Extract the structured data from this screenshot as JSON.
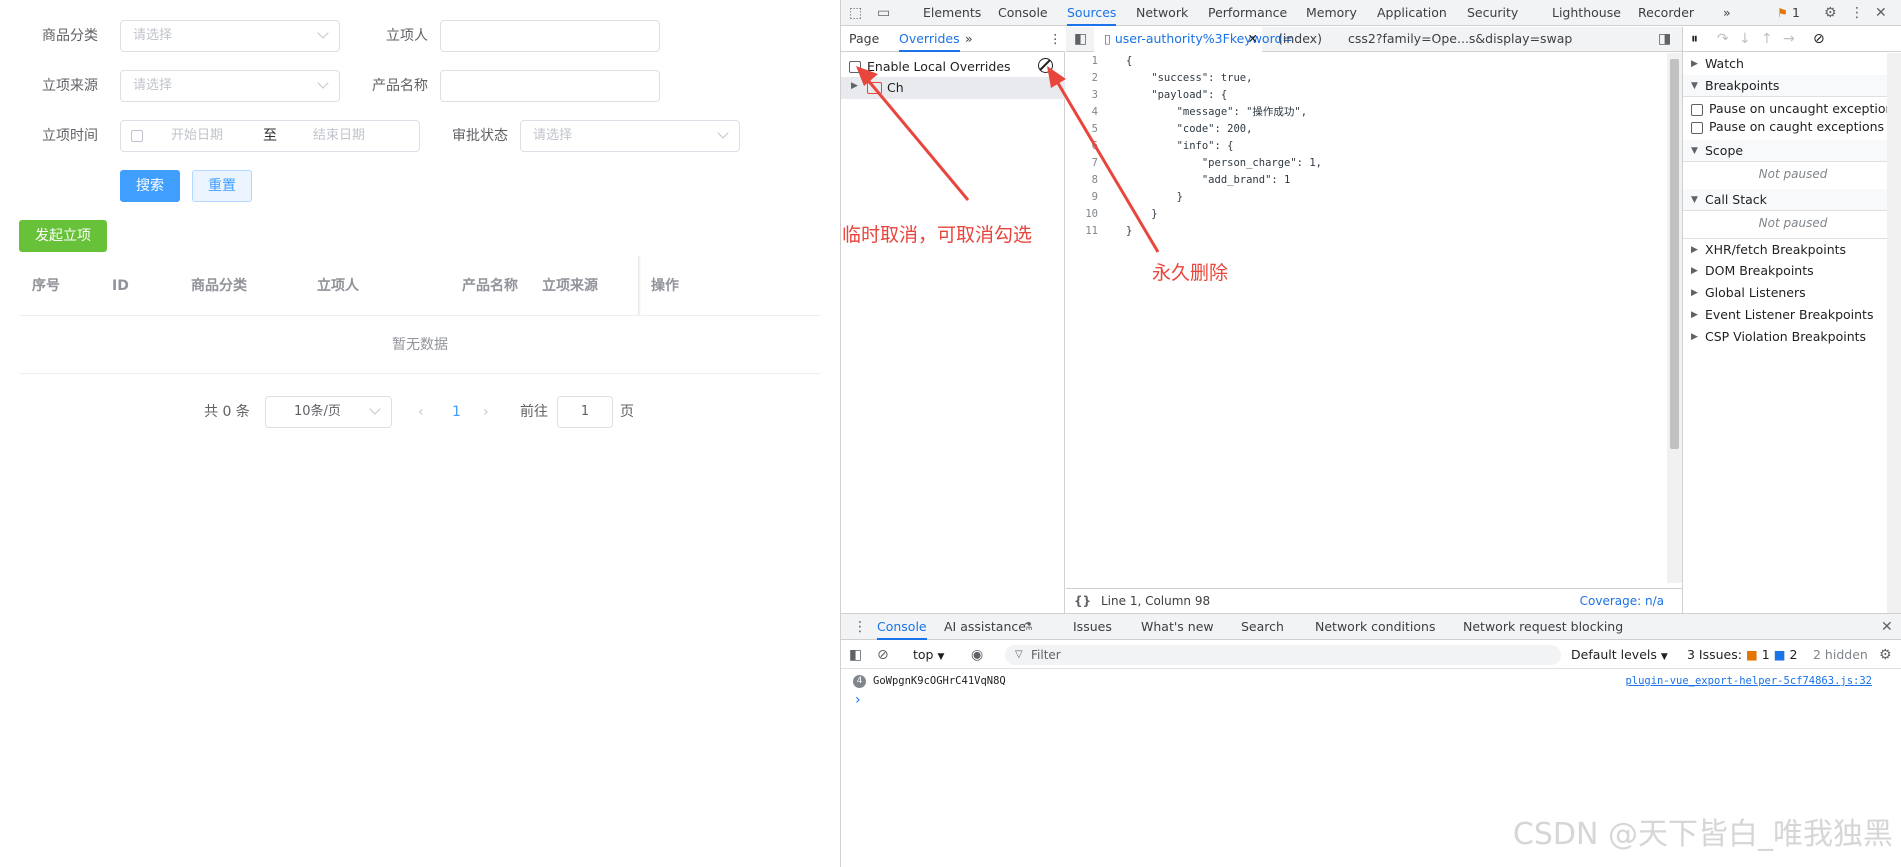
{
  "form": {
    "category_label": "商品分类",
    "category_placeholder": "请选择",
    "initiator_label": "立项人",
    "initiator_value": "",
    "source_label": "立项来源",
    "source_placeholder": "请选择",
    "product_label": "产品名称",
    "product_value": "",
    "time_label": "立项时间",
    "start_placeholder": "开始日期",
    "range_sep": "至",
    "end_placeholder": "结束日期",
    "status_label": "审批状态",
    "status_placeholder": "请选择",
    "search_button": "搜索",
    "reset_button": "重置"
  },
  "create_button": "发起立项",
  "table": {
    "columns": [
      "序号",
      "ID",
      "商品分类",
      "立项人",
      "产品名称",
      "立项来源",
      "操作"
    ],
    "empty_text": "暂无数据"
  },
  "pagination": {
    "total": "共 0 条",
    "page_size": "10条/页",
    "current_page": "1",
    "goto_label": "前往",
    "goto_value": "1",
    "page_suffix": "页"
  },
  "devtools": {
    "main_tabs": [
      "Elements",
      "Console",
      "Sources",
      "Network",
      "Performance",
      "Memory",
      "Application",
      "Security",
      "Lighthouse",
      "Recorder"
    ],
    "active_tab": "Sources",
    "more_tabs": "»",
    "issues_badge": "1",
    "sources_subtabs": [
      "Page",
      "Overrides"
    ],
    "active_subtab": "Overrides",
    "enable_overrides_label": "Enable Local Overrides",
    "folder_name": "Ch",
    "editor_tabs": [
      "user-authority%3Fkeyword=",
      "(index)",
      "css2?family=Ope...s&display=swap"
    ],
    "active_editor_tab": "user-authority%3Fkeyword=",
    "code_lines": [
      "{",
      "    \"success\": true,",
      "    \"payload\": {",
      "        \"message\": \"操作成功\",",
      "        \"code\": 200,",
      "        \"info\": {",
      "            \"person_charge\": 1,",
      "            \"add_brand\": 1",
      "        }",
      "    }",
      "}"
    ],
    "line_numbers": [
      "1",
      "2",
      "3",
      "4",
      "5",
      "6",
      "7",
      "8",
      "9",
      "10",
      "11"
    ],
    "status_position": "Line 1, Column 98",
    "coverage": "Coverage: n/a",
    "debugger": {
      "watch": "Watch",
      "breakpoints": "Breakpoints",
      "pause_uncaught": "Pause on uncaught exceptions",
      "pause_caught": "Pause on caught exceptions",
      "scope": "Scope",
      "scope_state": "Not paused",
      "call_stack": "Call Stack",
      "call_stack_state": "Not paused",
      "xhr": "XHR/fetch Breakpoints",
      "dom": "DOM Breakpoints",
      "global": "Global Listeners",
      "event": "Event Listener Breakpoints",
      "csp": "CSP Violation Breakpoints"
    },
    "drawer_tabs": [
      "Console",
      "AI assistance",
      "Issues",
      "What's new",
      "Search",
      "Network conditions",
      "Network request blocking"
    ],
    "active_drawer_tab": "Console",
    "console_context": "top",
    "filter_placeholder": "Filter",
    "default_levels": "Default levels",
    "issues_label": "3 Issues:",
    "issues_red": "1",
    "issues_blue": "2",
    "hidden_label": "2 hidden",
    "log_count": "4",
    "log_message": "GoWpgnK9cOGHrC41VqN8Q",
    "log_source": "plugin-vue_export-helper-5cf74863.js:32",
    "prompt": "›"
  },
  "annotations": {
    "temp_cancel": "临时取消，可取消勾选",
    "permanent_delete": "永久删除"
  },
  "watermark": "CSDN @天下皆白_唯我独黑",
  "colors": {
    "primary": "#409eff",
    "success": "#67c23a",
    "devtools_accent": "#1a73e8",
    "annotation": "#e8453c"
  }
}
